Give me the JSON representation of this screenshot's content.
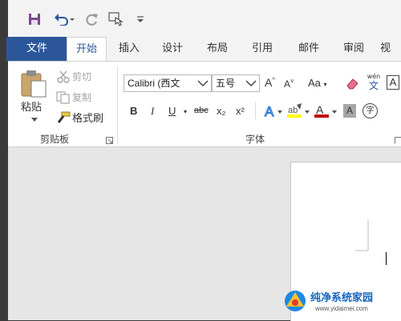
{
  "colors": {
    "brand": "#2b579a",
    "red": "#c00000",
    "highlight": "#ffff00"
  },
  "tabs": [
    {
      "label": "文件"
    },
    {
      "label": "开始"
    },
    {
      "label": "插入"
    },
    {
      "label": "设计"
    },
    {
      "label": "布局"
    },
    {
      "label": "引用"
    },
    {
      "label": "邮件"
    },
    {
      "label": "审阅"
    },
    {
      "label": "视"
    }
  ],
  "clipboard": {
    "paste_label": "粘贴",
    "cut_label": "剪切",
    "copy_label": "复制",
    "format_painter_label": "格式刷",
    "group_label": "剪贴板"
  },
  "font": {
    "font_name": "Calibri (西文 ",
    "font_size": "五号",
    "change_case_label": "Aa",
    "phonetic_top": "wén",
    "char_border": "A",
    "bold": "B",
    "italic": "I",
    "underline": "U",
    "strike": "abc",
    "subscript": "x₂",
    "superscript": "x²",
    "group_label": "字体",
    "enclose_char": "字"
  },
  "watermark": {
    "site": "纯净系统家园",
    "url": "www.yidaimei.com"
  }
}
